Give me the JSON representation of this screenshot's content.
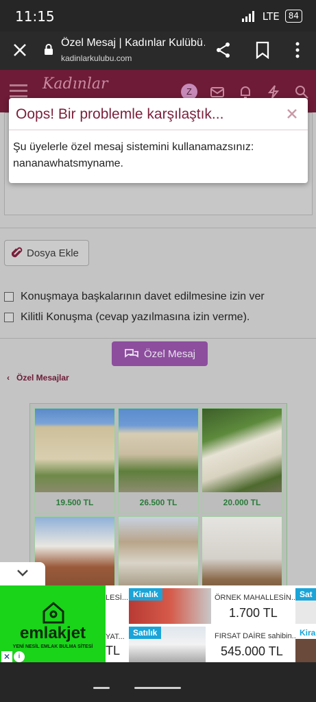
{
  "status_bar": {
    "time": "11:15",
    "network": "LTE",
    "battery": "84"
  },
  "browser": {
    "title": "Özel Mesaj | Kadınlar Kulübü…",
    "url": "kadinlarkulubu.com"
  },
  "site": {
    "logo_text": "Kadınlar",
    "avatar_letter": "Z",
    "brand_color": "#6d1b37"
  },
  "modal": {
    "title": "Oops! Bir problemle karşılaştık...",
    "message_line1": "Şu üyelerle özel mesaj sistemini kullanamazsınız:",
    "message_line2": "nananawhatsmyname."
  },
  "form": {
    "attach_label": "Dosya Ekle",
    "option_invite": "Konuşmaya başkalarının davet edilmesine izin ver",
    "option_lock": "Kilitli Konuşma (cevap yazılmasına izin verme).",
    "submit_label": "Özel Mesaj"
  },
  "breadcrumb": {
    "label": "Özel Mesajlar"
  },
  "listings": [
    {
      "price": "19.500 TL"
    },
    {
      "price": "26.500 TL"
    },
    {
      "price": "20.000 TL"
    },
    {
      "price": ""
    },
    {
      "price": ""
    },
    {
      "price": ""
    }
  ],
  "ad": {
    "brand": "emlakjet",
    "tagline": "YENİ NESİL EMLAK BULMA SİTESİ",
    "left_col": [
      {
        "desc": "LESİ...",
        "price": ""
      },
      {
        "desc": "YAT...",
        "price": "TL"
      }
    ],
    "tiles": [
      {
        "tag": "Kiralık",
        "desc": "ÖRNEK MAHALLESİN...",
        "price": "1.700 TL"
      },
      {
        "tag": "Satılık",
        "desc": "FIRSAT DAİRE sahibin...",
        "price": "545.000 TL"
      }
    ],
    "right_tags": [
      "Sat",
      "Kira"
    ]
  }
}
